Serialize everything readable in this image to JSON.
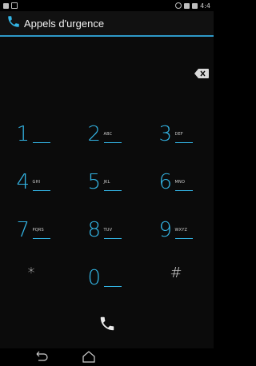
{
  "status_bar": {
    "time": "4:4",
    "icons": [
      "image-icon",
      "doc-icon",
      "sync-icon",
      "signal-icon",
      "battery-icon"
    ]
  },
  "action_bar": {
    "title": "Appels d'urgence",
    "icon": "phone-icon"
  },
  "dial_field": {
    "value": ""
  },
  "keypad": [
    {
      "digit": "1",
      "letters": ""
    },
    {
      "digit": "2",
      "letters": "ABC"
    },
    {
      "digit": "3",
      "letters": "DEF"
    },
    {
      "digit": "4",
      "letters": "GHI"
    },
    {
      "digit": "5",
      "letters": "JKL"
    },
    {
      "digit": "6",
      "letters": "MNO"
    },
    {
      "digit": "7",
      "letters": "PQRS"
    },
    {
      "digit": "8",
      "letters": "TUV"
    },
    {
      "digit": "9",
      "letters": "WXYZ"
    },
    {
      "digit": "*",
      "letters": ""
    },
    {
      "digit": "0",
      "letters": ""
    },
    {
      "digit": "#",
      "letters": ""
    }
  ],
  "colors": {
    "accent": "#33b5e5",
    "background": "#0b0b0b"
  }
}
